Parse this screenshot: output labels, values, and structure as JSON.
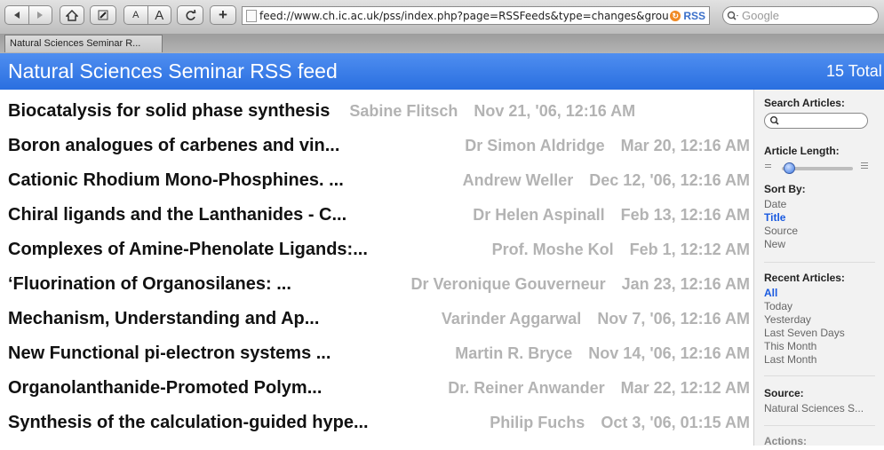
{
  "toolbar": {
    "url": "feed://www.ch.ic.ac.uk/pss/index.php?page=RSSFeeds&type=changes&group=",
    "rss_label": "RSS",
    "search_placeholder": "Google",
    "text_small": "A",
    "text_large": "A",
    "add_label": "+"
  },
  "tab": {
    "title": "Natural Sciences Seminar R..."
  },
  "feed": {
    "title": "Natural Sciences Seminar RSS feed",
    "total": "15 Total"
  },
  "articles": [
    {
      "title": "Biocatalysis for solid phase synthesis",
      "source": "Sabine Flitsch",
      "date": "Nov 21, '06, 12:16 AM"
    },
    {
      "title": "Boron analogues of carbenes and vin...",
      "source": "Dr Simon Aldridge",
      "date": "Mar 20, 12:16 AM"
    },
    {
      "title": "Cationic Rhodium Mono-Phosphines. ...",
      "source": "Andrew Weller",
      "date": "Dec 12, '06, 12:16 AM"
    },
    {
      "title": "Chiral ligands and the Lanthanides - C...",
      "source": "Dr Helen Aspinall",
      "date": "Feb 13, 12:16 AM"
    },
    {
      "title": "Complexes of Amine-Phenolate Ligands:...",
      "source": "Prof. Moshe Kol",
      "date": "Feb 1, 12:12 AM"
    },
    {
      "title": "‘Fluorination of Organosilanes: ...",
      "source": "Dr Veronique Gouverneur",
      "date": "Jan 23, 12:16 AM"
    },
    {
      "title": "Mechanism, Understanding and Ap...",
      "source": "Varinder Aggarwal",
      "date": "Nov 7, '06, 12:16 AM"
    },
    {
      "title": "New Functional pi-electron systems ...",
      "source": "Martin R. Bryce",
      "date": "Nov 14, '06, 12:16 AM"
    },
    {
      "title": "Organolanthanide-Promoted Polym...",
      "source": "Dr. Reiner Anwander",
      "date": "Mar 22, 12:12 AM"
    },
    {
      "title": "Synthesis of the calculation-guided hype...",
      "source": "Philip Fuchs",
      "date": "Oct 3, '06, 01:15 AM"
    }
  ],
  "sidebar": {
    "search_label": "Search Articles:",
    "length_label": "Article Length:",
    "article_length_level": 0.1,
    "sort_label": "Sort By:",
    "sort_items": [
      "Date",
      "Title",
      "Source",
      "New"
    ],
    "sort_active": "Title",
    "recent_label": "Recent Articles:",
    "recent_items": [
      "All",
      "Today",
      "Yesterday",
      "Last Seven Days",
      "This Month",
      "Last Month"
    ],
    "recent_active": "All",
    "source_label": "Source:",
    "source_value": "Natural Sciences S...",
    "actions_label": "Actions:"
  },
  "colors": {
    "header_blue": "#2a6fe0",
    "active_link": "#1a5ae0",
    "muted_text": "#b3b3b3"
  }
}
